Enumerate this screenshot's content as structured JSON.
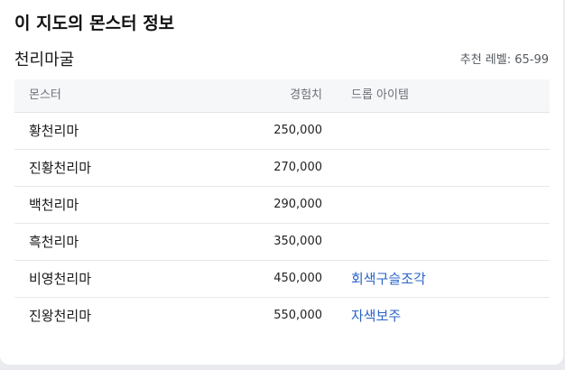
{
  "card": {
    "title": "이 지도의 몬스터 정보"
  },
  "map": {
    "name": "천리마굴",
    "recommended_level": "추천 레벨: 65-99"
  },
  "table": {
    "headers": {
      "monster": "몬스터",
      "exp": "경험치",
      "drop": "드롭 아이템"
    },
    "rows": [
      {
        "monster": "황천리마",
        "exp": "250,000",
        "drop": ""
      },
      {
        "monster": "진황천리마",
        "exp": "270,000",
        "drop": ""
      },
      {
        "monster": "백천리마",
        "exp": "290,000",
        "drop": ""
      },
      {
        "monster": "흑천리마",
        "exp": "350,000",
        "drop": ""
      },
      {
        "monster": "비영천리마",
        "exp": "450,000",
        "drop": "회색구슬조각"
      },
      {
        "monster": "진왕천리마",
        "exp": "550,000",
        "drop": "자색보주"
      }
    ]
  },
  "colors": {
    "link": "#2a63c7",
    "header_bg": "#f6f7f9"
  }
}
